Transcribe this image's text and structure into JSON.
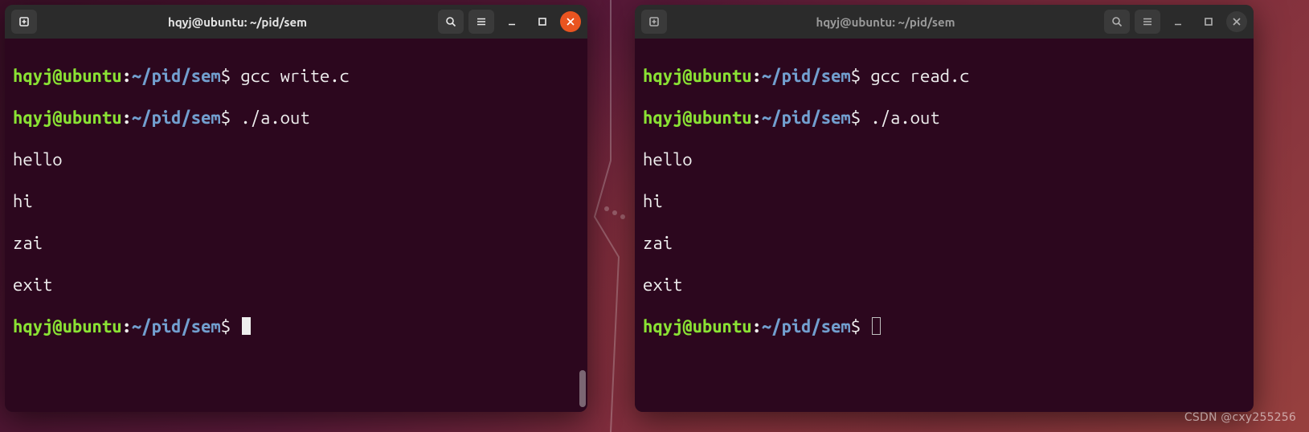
{
  "desktop": {
    "watermark": "CSDN @cxy255256"
  },
  "terminals": {
    "left": {
      "title": "hqyj@ubuntu: ~/pid/sem",
      "focused": true,
      "prompt": {
        "user": "hqyj@ubuntu",
        "sep": ":",
        "path": "~/pid/sem",
        "sym": "$"
      },
      "lines": {
        "cmd1": "gcc write.c",
        "cmd2": "./a.out",
        "out1": "hello",
        "out2": "hi",
        "out3": "zai",
        "out4": "exit"
      }
    },
    "right": {
      "title": "hqyj@ubuntu: ~/pid/sem",
      "focused": false,
      "prompt": {
        "user": "hqyj@ubuntu",
        "sep": ":",
        "path": "~/pid/sem",
        "sym": "$"
      },
      "lines": {
        "cmd1": "gcc read.c",
        "cmd2": "./a.out",
        "out1": "hello",
        "out2": "hi",
        "out3": "zai",
        "out4": "exit"
      }
    }
  },
  "icons": {
    "newtab": "new-tab-icon",
    "search": "search-icon",
    "menu": "hamburger-icon",
    "min": "minimize-icon",
    "max": "maximize-icon",
    "close": "close-icon"
  }
}
